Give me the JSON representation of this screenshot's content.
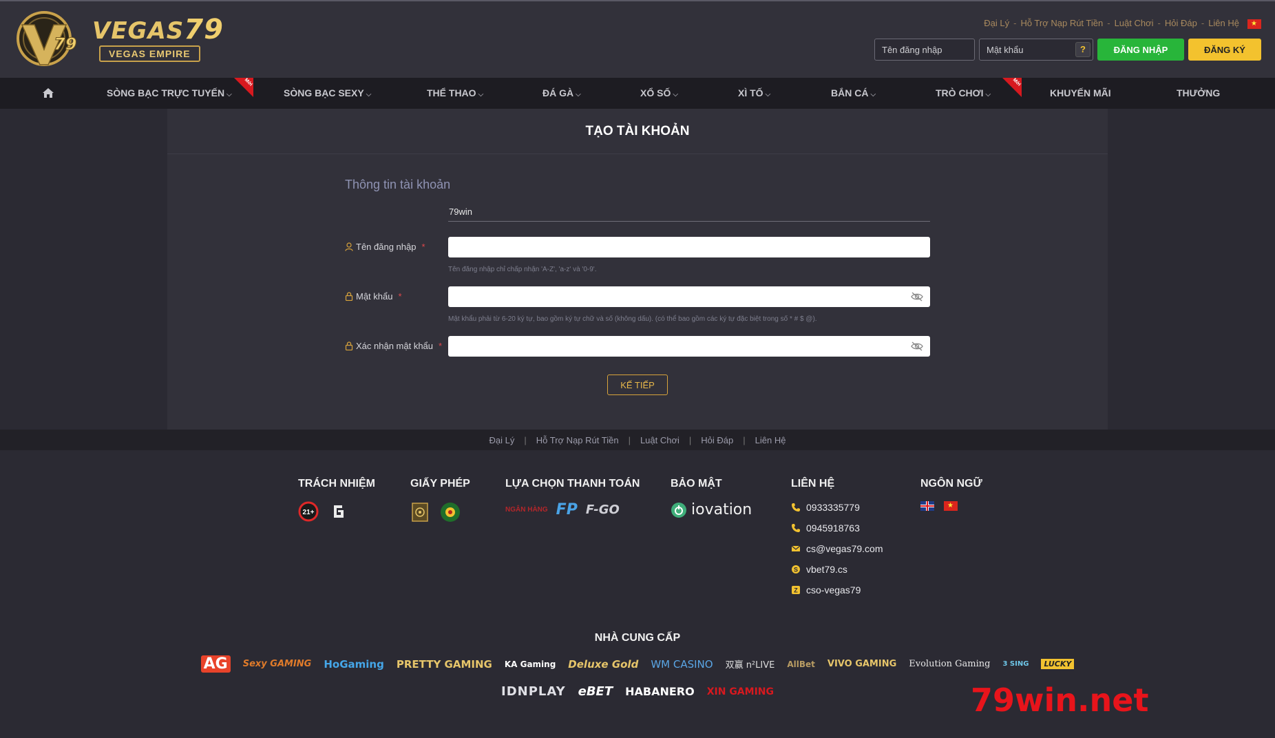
{
  "header": {
    "logo": {
      "title": "VEGAS",
      "title_num": "79",
      "subtitle": "VEGAS EMPIRE"
    },
    "top_links": [
      "Đại Lý",
      "Hỗ Trợ Nạp Rút Tiền",
      "Luật Chơi",
      "Hỏi Đáp",
      "Liên Hệ"
    ],
    "login": {
      "username_placeholder": "Tên đăng nhập",
      "password_placeholder": "Mật khẩu",
      "help_label": "?",
      "login_label": "ĐĂNG NHẬP",
      "register_label": "ĐĂNG KÝ"
    }
  },
  "nav": {
    "items": [
      {
        "label": "SÒNG BẠC TRỰC TUYẾN",
        "badge": "Mới"
      },
      {
        "label": "SÒNG BẠC SEXY"
      },
      {
        "label": "THỂ THAO"
      },
      {
        "label": "ĐÁ GÀ"
      },
      {
        "label": "XỔ SỐ"
      },
      {
        "label": "XÌ TỐ"
      },
      {
        "label": "BẮN CÁ"
      },
      {
        "label": "TRÒ CHƠI",
        "badge": "Mới"
      },
      {
        "label": "KHUYẾN MÃI"
      },
      {
        "label": "THƯỞNG"
      }
    ]
  },
  "form": {
    "page_title": "TẠO TÀI KHOẢN",
    "section_title": "Thông tin tài khoản",
    "prefill_value": "79win",
    "username_label": "Tên đăng nhập",
    "username_hint": "Tên đăng nhập chỉ chấp nhận 'A-Z', 'a-z' và '0-9'.",
    "password_label": "Mật khẩu",
    "password_hint": "Mật khẩu phải từ 6-20 ký tự, bao gồm ký tự chữ và số (không dấu). (có thể bao gồm các ký tự đặc biệt trong số * # $ @).",
    "confirm_label": "Xác nhận mật khẩu",
    "required_mark": "*",
    "next_label": "KẾ TIẾP"
  },
  "footer": {
    "links": [
      "Đại Lý",
      "Hỗ Trợ Nạp Rút Tiền",
      "Luật Chơi",
      "Hỏi Đáp",
      "Liên Hệ"
    ],
    "responsibility_title": "TRÁCH NHIỆM",
    "age_badge": "21+",
    "license_title": "GIẤY PHÉP",
    "payment_title": "LỰA CHỌN THANH TOÁN",
    "payment_bank": "NGÂN HÀNG",
    "payment_fp": "FP",
    "payment_fgo": "F-GO",
    "security_title": "BẢO MẬT",
    "security_brand": "iovation",
    "contact_title": "LIÊN HỆ",
    "contacts": [
      {
        "icon": "phone-icon",
        "text": "0933335779"
      },
      {
        "icon": "phone-icon",
        "text": "0945918763"
      },
      {
        "icon": "mail-icon",
        "text": "cs@vegas79.com"
      },
      {
        "icon": "skype-icon",
        "text": "vbet79.cs"
      },
      {
        "icon": "zalo-icon",
        "text": "cso-vegas79"
      }
    ],
    "language_title": "NGÔN NGỮ",
    "providers_title": "NHÀ CUNG CẤP",
    "providers_row1": [
      "AG",
      "Sexy GAMING",
      "HoGaming",
      "PRETTY GAMING",
      "KA Gaming",
      "Deluxe Gold",
      "WM CASINO",
      "双赢 n²LIVE",
      "AllBet",
      "VIVO GAMING",
      "Evolution Gaming",
      "3 SING",
      "LUCKY"
    ],
    "providers_row2": [
      "IDNPLAY",
      "eBET",
      "HABANERO",
      "XIN GAMING"
    ]
  },
  "watermark": "79win.net",
  "colors": {
    "accent_gold": "#e6c56a",
    "login_green": "#28b53a",
    "register_yellow": "#f3c22e",
    "badge_red": "#d7191f",
    "watermark_red": "#e8141b"
  }
}
